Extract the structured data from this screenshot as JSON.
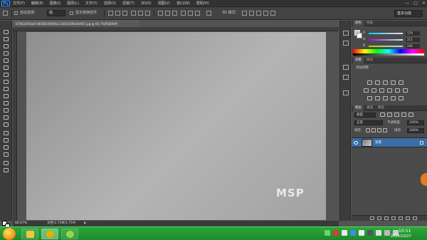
{
  "app": {
    "logo": "Ps"
  },
  "menu": [
    "文件(F)",
    "编辑(E)",
    "图像(I)",
    "图层(L)",
    "文字(Y)",
    "选择(S)",
    "滤镜(T)",
    "3D(D)",
    "视图(V)",
    "窗口(W)",
    "帮助(H)"
  ],
  "window_controls": {
    "minimize": "—",
    "maximize": "□",
    "close": "✕"
  },
  "options_bar": {
    "auto_select_label": "自动选择：",
    "auto_select_value": "组",
    "show_transform_label": "显示变换控件",
    "mode_3d_label": "3D 模式：",
    "workspace": "基本功能"
  },
  "document": {
    "tab_title": "b7903af03a87e85082d569fa113853436fa0b467.jpg @ 66.7%(RGB/8#)",
    "watermark": "MSP",
    "zoom": "66.67%",
    "doc_info": "文档:1.71M/1.71M",
    "status_arrow": "▶"
  },
  "color_panel": {
    "tabs": [
      "颜色",
      "色板"
    ],
    "sliders": [
      {
        "label": "R",
        "value": "179",
        "gradient": "linear-gradient(90deg,#00d3f0,#ffd3f0)"
      },
      {
        "label": "G",
        "value": "211",
        "gradient": "linear-gradient(90deg,#af00f0,#afffF0)"
      },
      {
        "label": "B",
        "value": "246",
        "gradient": "linear-gradient(90deg,#afd300,#afd3ff)"
      }
    ],
    "foreground": "#afd3f0",
    "background": "#ffffff"
  },
  "adjustments_panel": {
    "tabs": [
      "调整",
      "样式"
    ],
    "title": "添加调整"
  },
  "layers_panel": {
    "tabs": [
      "图层",
      "通道",
      "路径"
    ],
    "kind_label": "类型",
    "blend_mode": "正常",
    "opacity_label": "不透明度:",
    "opacity_value": "100%",
    "lock_label": "锁定:",
    "fill_label": "填充:",
    "fill_value": "100%",
    "layer_name": "背景"
  },
  "taskbar": {
    "time": "10:51",
    "date": "2014/10/27"
  }
}
